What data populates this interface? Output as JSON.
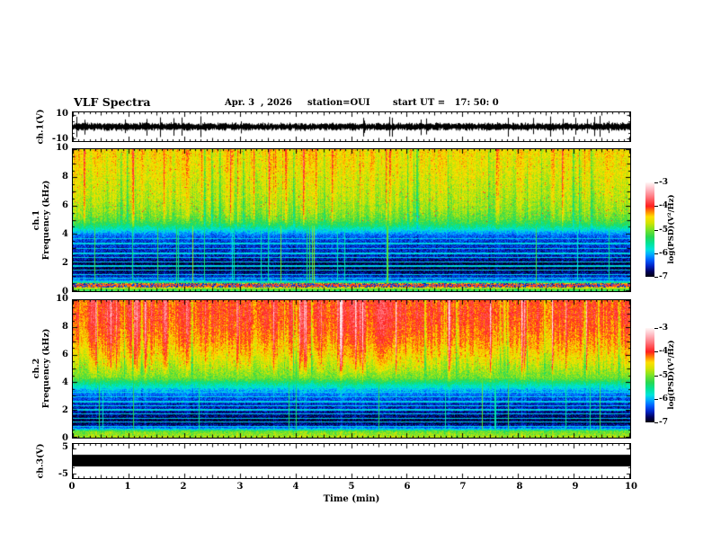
{
  "header": {
    "title": "VLF Spectra",
    "date": "Apr. 3  , 2026",
    "station": "station=OUI",
    "start_ut": "start UT =   17: 50: 0"
  },
  "x_axis": {
    "label": "Time (min)",
    "tick_values": [
      0,
      1,
      2,
      3,
      4,
      5,
      6,
      7,
      8,
      9,
      10
    ],
    "tick_labels": [
      "0",
      "1",
      "2",
      "3",
      "4",
      "5",
      "6",
      "7",
      "8",
      "9",
      "10"
    ],
    "minor_step": 0.1
  },
  "panels": [
    {
      "id": "ch1-wave",
      "ylabel": "ch.1(V)",
      "ymin": -10,
      "ymax": 10,
      "ytick_values": [
        10,
        -10
      ],
      "ytick_labels": [
        "10",
        "-10"
      ]
    },
    {
      "id": "ch1-spec",
      "ylabel_line1": "ch.1",
      "ylabel_line2": "Frequency (kHz)",
      "ymin": 0,
      "ymax": 10,
      "ytick_values": [
        10,
        8,
        6,
        4,
        2,
        0
      ],
      "ytick_labels": [
        "10",
        "8",
        "6",
        "4",
        "2",
        "0"
      ]
    },
    {
      "id": "ch2-spec",
      "ylabel_line1": "ch.2",
      "ylabel_line2": "Frequency (kHz)",
      "ymin": 0,
      "ymax": 10,
      "ytick_values": [
        10,
        8,
        6,
        4,
        2,
        0
      ],
      "ytick_labels": [
        "10",
        "8",
        "6",
        "4",
        "2",
        "0"
      ]
    },
    {
      "id": "ch3-wave",
      "ylabel": "ch.3(V)",
      "ymin": -5,
      "ymax": 5,
      "ytick_values": [
        5,
        -5
      ],
      "ytick_labels": [
        "5",
        "-5"
      ]
    }
  ],
  "colorbar": {
    "label": "log(PSD)(V²/Hz)",
    "tick_values": [
      -3,
      -4,
      -5,
      -6,
      -7
    ],
    "tick_labels": [
      "-3",
      "-4",
      "-5",
      "-6",
      "-7"
    ],
    "vmin": -7,
    "vmax": -3,
    "stops": [
      {
        "v": -7.0,
        "c": "#000014"
      },
      {
        "v": -6.8,
        "c": "#00005a"
      },
      {
        "v": -6.55,
        "c": "#0026c8"
      },
      {
        "v": -6.3,
        "c": "#0060ff"
      },
      {
        "v": -6.05,
        "c": "#00b0ff"
      },
      {
        "v": -5.85,
        "c": "#00e4dc"
      },
      {
        "v": -5.6,
        "c": "#00e49c"
      },
      {
        "v": -5.3,
        "c": "#2cd850"
      },
      {
        "v": -5.0,
        "c": "#7ce428"
      },
      {
        "v": -4.7,
        "c": "#d8e400"
      },
      {
        "v": -4.45,
        "c": "#ffe000"
      },
      {
        "v": -4.25,
        "c": "#ff9000"
      },
      {
        "v": -4.0,
        "c": "#ff2020"
      },
      {
        "v": -3.6,
        "c": "#ff7880"
      },
      {
        "v": -3.25,
        "c": "#ffc0c8"
      },
      {
        "v": -3.0,
        "c": "#fff4f4"
      }
    ]
  },
  "chart_data": [
    {
      "type": "line",
      "name": "ch.1 waveform",
      "ylabel": "ch.1(V)",
      "xlabel": "Time (min)",
      "xlim": [
        0,
        10
      ],
      "ylim": [
        -10,
        10
      ],
      "signal": {
        "kind": "broadband noise",
        "mean_v": 0,
        "typical_amplitude_v": 3,
        "spike_amplitude_v": 10
      }
    },
    {
      "type": "heatmap",
      "name": "ch.1 VLF spectrogram",
      "ylabel": "ch.1 Frequency (kHz)",
      "xlabel": "Time (min)",
      "xlim": [
        0,
        10
      ],
      "ylim": [
        0,
        10
      ],
      "color_scale": {
        "label": "log(PSD)(V²/Hz)",
        "min": -7,
        "max": -3
      },
      "profile": {
        "freq_khz": [
          0,
          0.12,
          0.22,
          0.3,
          0.5,
          0.58,
          0.75,
          1.0,
          1.3,
          1.6,
          2.0,
          2.3,
          2.7,
          3.1,
          3.5,
          3.9,
          4.2,
          4.6,
          5.0,
          5.6,
          6.5,
          7.5,
          8.5,
          10
        ],
        "psd": [
          -5.3,
          -5.1,
          -4.6,
          -4.05,
          -4.1,
          -5.6,
          -6.25,
          -6.5,
          -6.75,
          -6.85,
          -6.85,
          -6.6,
          -6.55,
          -6.5,
          -6.45,
          -6.3,
          -5.95,
          -5.45,
          -5.15,
          -4.95,
          -4.8,
          -4.7,
          -4.6,
          -4.5
        ]
      },
      "interference_lines_khz": [
        0.65,
        0.9,
        1.15,
        1.45,
        1.75,
        2.05,
        2.35,
        2.65,
        3.0,
        3.35,
        3.7
      ],
      "low_freq_red_band_khz": [
        0.24,
        0.55
      ],
      "features": [
        "yellow-green background above 5 kHz with vertical yellow/red streaks",
        "dark blue band 1.3-4 kHz with thin cyan horizontal lines",
        "dark red band near 0.3-0.5 kHz"
      ]
    },
    {
      "type": "heatmap",
      "name": "ch.2 VLF spectrogram",
      "ylabel": "ch.2 Frequency (kHz)",
      "xlabel": "Time (min)",
      "xlim": [
        0,
        10
      ],
      "ylim": [
        0,
        10
      ],
      "color_scale": {
        "label": "log(PSD)(V²/Hz)",
        "min": -7,
        "max": -3
      },
      "profile": {
        "freq_khz": [
          0,
          0.2,
          0.45,
          0.6,
          0.8,
          1.0,
          1.3,
          1.7,
          2.1,
          2.5,
          2.9,
          3.3,
          3.7,
          4.0,
          4.35,
          4.7,
          5.2,
          6.0,
          7.0,
          8.0,
          9.0,
          10
        ],
        "psd": [
          -4.85,
          -4.95,
          -5.1,
          -6.0,
          -6.55,
          -6.8,
          -6.85,
          -6.7,
          -6.6,
          -6.5,
          -6.35,
          -6.15,
          -5.8,
          -5.45,
          -5.05,
          -4.95,
          -4.75,
          -4.5,
          -4.25,
          -4.1,
          -4.0,
          -4.05
        ]
      },
      "interference_lines_khz": [
        0.8,
        1.1,
        1.4,
        1.7,
        2.0,
        2.3,
        2.6,
        2.95,
        3.3,
        3.65,
        4.0
      ],
      "low_freq_red_band_khz": null,
      "features": [
        "orange/red band 8-10 kHz with strong red vertical streaks",
        "yellow band 5-8 kHz",
        "dark blue band 0.8-3.5 kHz with cyan horizontal lines",
        "bright green band near 0-0.5 kHz"
      ]
    },
    {
      "type": "line",
      "name": "ch.3 waveform",
      "ylabel": "ch.3(V)",
      "xlabel": "Time (min)",
      "xlim": [
        0,
        10
      ],
      "ylim": [
        -5,
        5
      ],
      "signal": {
        "kind": "constant",
        "value_v": 0,
        "line_thickness_v": 1.5
      }
    }
  ]
}
